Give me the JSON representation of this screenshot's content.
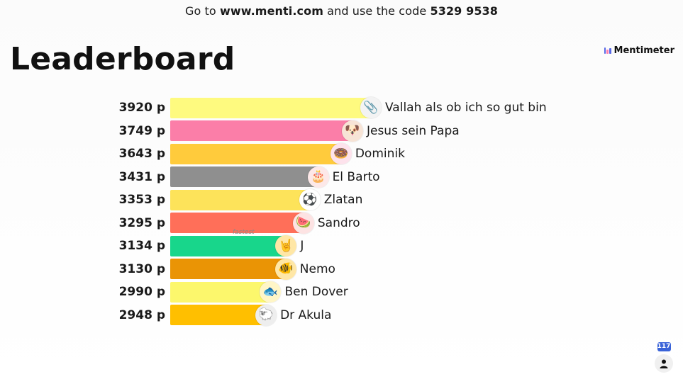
{
  "header": {
    "instruction_prefix": "Go to",
    "url": "www.menti.com",
    "instruction_middle": "and use the code",
    "code": "5329 9538"
  },
  "title": "Leaderboard",
  "brand": {
    "name": "Mentimeter"
  },
  "leaderboard": {
    "entries": [
      {
        "score": "3920 p",
        "name": "Vallah als ob ich so gut bin",
        "color": "#fefa7f",
        "avatar_icon": "paperclip-icon",
        "avatar_glyph": "📎",
        "avatar_bg": "#f3f3f3"
      },
      {
        "score": "3749 p",
        "name": "Jesus sein Papa",
        "color": "#fb7ea8",
        "avatar_icon": "dog-face-icon",
        "avatar_glyph": "🐶",
        "avatar_bg": "#f7e4d6"
      },
      {
        "score": "3643 p",
        "name": "Dominik",
        "color": "#ffcb3c",
        "avatar_icon": "donut-icon",
        "avatar_glyph": "🍩",
        "avatar_bg": "#fde2ec"
      },
      {
        "score": "3431 p",
        "name": "El Barto",
        "color": "#8f8f8f",
        "avatar_icon": "cake-icon",
        "avatar_glyph": "🎂",
        "avatar_bg": "#fde8e8"
      },
      {
        "score": "3353 p",
        "name": "Zlatan",
        "color": "#fde35a",
        "avatar_icon": "soccer-ball-icon",
        "avatar_glyph": "⚽",
        "avatar_bg": "#ffffff"
      },
      {
        "score": "3295 p",
        "name": "Sandro",
        "color": "#ff6f59",
        "avatar_icon": "watermelon-icon",
        "avatar_glyph": "🍉",
        "avatar_bg": "#fde3e3"
      },
      {
        "score": "3134 p",
        "name": "J",
        "color": "#18d68b",
        "avatar_icon": "rock-hand-icon",
        "avatar_glyph": "🤘",
        "avatar_bg": "#ffe7a6"
      },
      {
        "score": "3130 p",
        "name": "Nemo",
        "color": "#ea9405",
        "avatar_icon": "fish-icon",
        "avatar_glyph": "🐠",
        "avatar_bg": "#ffe7a6"
      },
      {
        "score": "2990 p",
        "name": "Ben Dover",
        "color": "#fcf76c",
        "avatar_icon": "tropical-fish-icon",
        "avatar_glyph": "🐟",
        "avatar_bg": "#fff6c7"
      },
      {
        "score": "2948 p",
        "name": "Dr Akula",
        "color": "#ffbf00",
        "avatar_icon": "lamb-icon",
        "avatar_glyph": "🐑",
        "avatar_bg": "#eeeeee"
      }
    ],
    "note": "fastest",
    "max_score": 3920
  },
  "participants": {
    "count": "117",
    "icon": "person-icon"
  }
}
